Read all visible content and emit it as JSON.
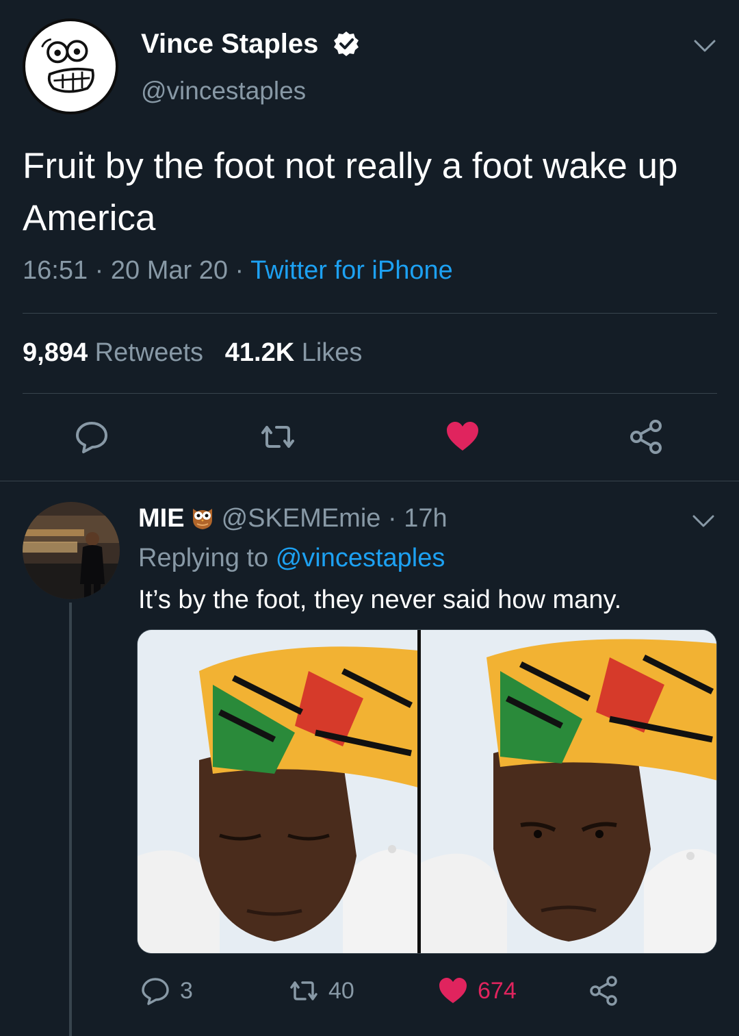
{
  "tweet": {
    "author_name": "Vince Staples",
    "author_handle": "@vincestaples",
    "text": "Fruit by the foot not really a foot wake up America",
    "time": "16:51",
    "date": "20 Mar 20",
    "source": "Twitter for iPhone",
    "retweet_count": "9,894",
    "retweet_label": "Retweets",
    "like_count": "41.2K",
    "like_label": "Likes",
    "icons": [
      "verified-badge-icon",
      "chevron-down-icon",
      "reply-icon",
      "retweet-icon",
      "heart-icon",
      "share-icon"
    ],
    "liked": true
  },
  "reply": {
    "author_name": "MIE",
    "author_handle": "@SKEMEmie",
    "age": "17h",
    "replying_prefix": "Replying to",
    "replying_to": "@vincestaples",
    "text": "It’s by the foot, they never said how many.",
    "reply_count": "3",
    "retweet_count": "40",
    "like_count": "674",
    "liked": true
  },
  "colors": {
    "background": "#141d26",
    "secondary_text": "#8899a6",
    "link": "#1da1f2",
    "like": "#e0245e",
    "divider": "#38444d"
  }
}
